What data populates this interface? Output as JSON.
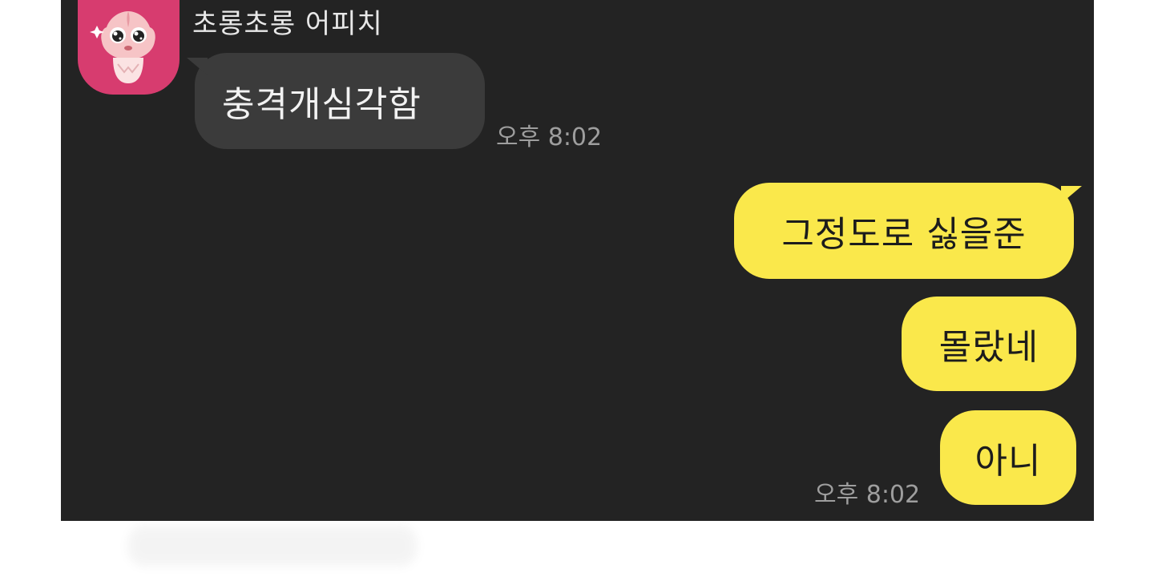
{
  "chat": {
    "background_color": "#232323",
    "incoming": {
      "sender_name": "초롱초롱 어피치",
      "avatar_icon": "apeach-crying-icon",
      "avatar_color": "#d73c6f",
      "message": "충격개심각함",
      "time": "오후 8:02"
    },
    "outgoing": {
      "bubble_color": "#fae84b",
      "messages": [
        {
          "text": "그정도로 싫을준"
        },
        {
          "text": "몰랐네"
        },
        {
          "text": "아니"
        }
      ],
      "time": "오후 8:02"
    }
  }
}
